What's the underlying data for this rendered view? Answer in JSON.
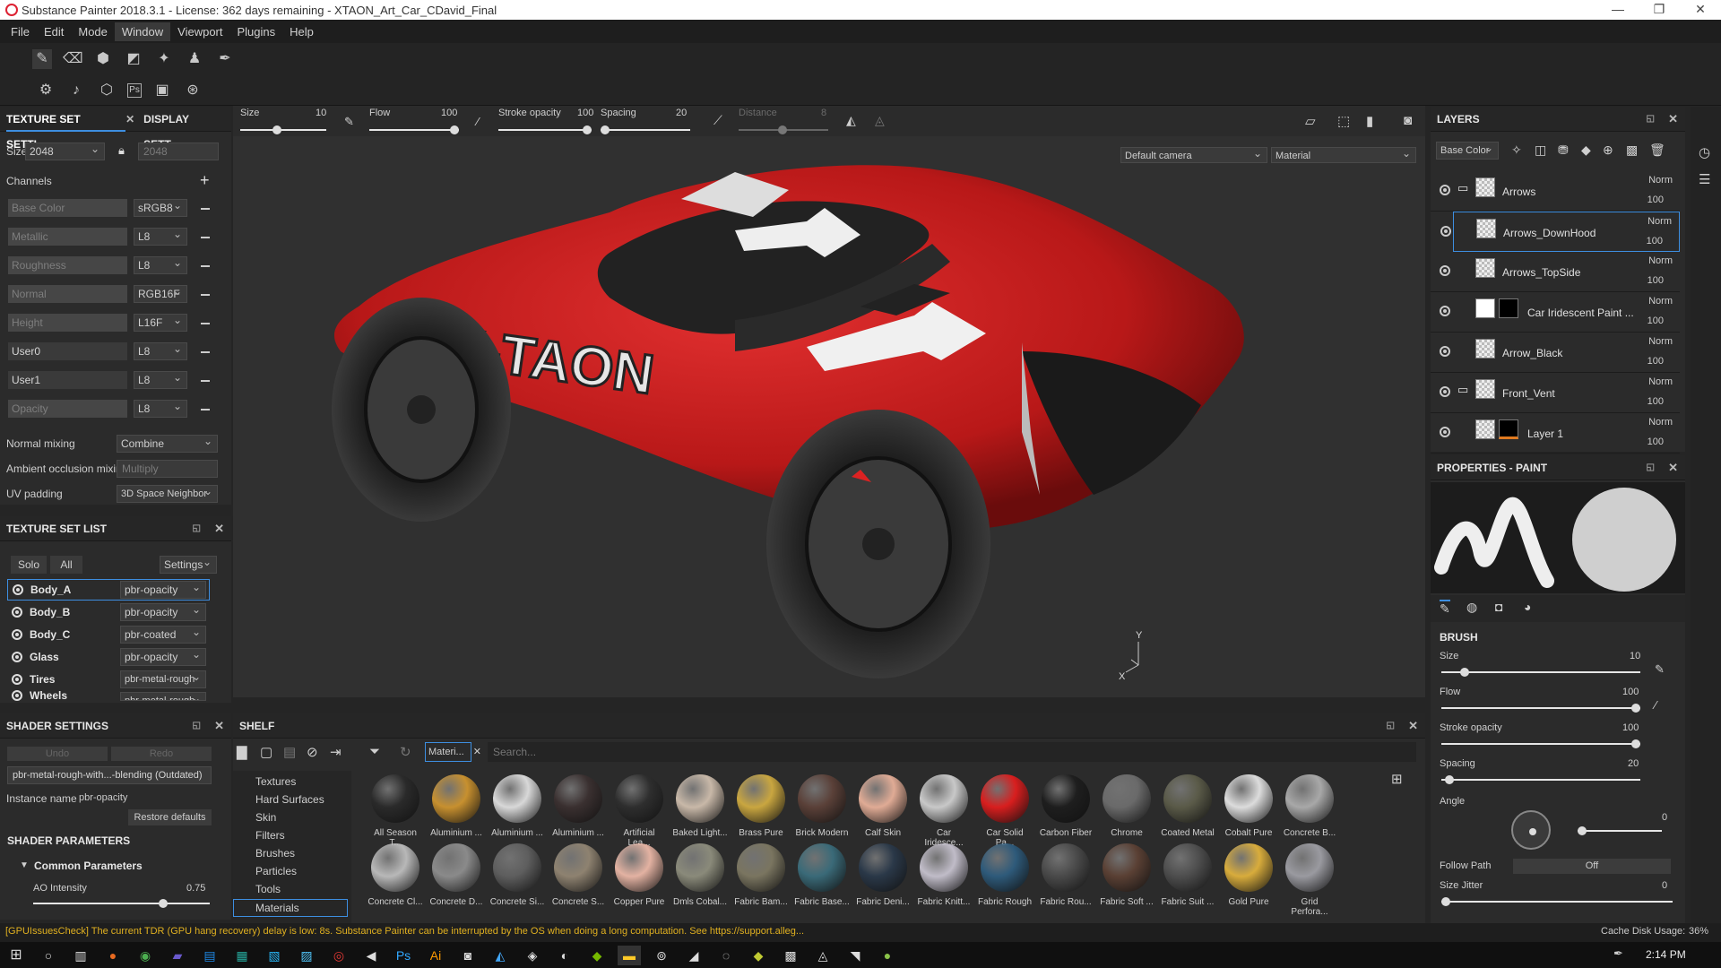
{
  "window": {
    "title": "Substance Painter 2018.3.1 - License: 362 days remaining - XTAON_Art_Car_CDavid_Final",
    "minimize": "—",
    "restore": "❐",
    "close": "✕"
  },
  "menu": [
    "File",
    "Edit",
    "Mode",
    "Window",
    "Viewport",
    "Plugins",
    "Help"
  ],
  "texture_set_settings": {
    "tab1": "TEXTURE SET SETTI...",
    "tab2": "DISPLAY SETT...",
    "size_label": "Size",
    "size_value": "2048",
    "size_value2": "2048",
    "channels_label": "Channels",
    "channels": [
      {
        "name": "Base Color",
        "format": "sRGB8"
      },
      {
        "name": "Metallic",
        "format": "L8"
      },
      {
        "name": "Roughness",
        "format": "L8"
      },
      {
        "name": "Normal",
        "format": "RGB16F"
      },
      {
        "name": "Height",
        "format": "L16F"
      },
      {
        "name": "User0",
        "format": "L8"
      },
      {
        "name": "User1",
        "format": "L8"
      },
      {
        "name": "Opacity",
        "format": "L8"
      }
    ],
    "normal_mixing_label": "Normal mixing",
    "normal_mixing": "Combine",
    "ao_mixing_label": "Ambient occlusion mixing",
    "ao_mixing": "Multiply",
    "uv_padding_label": "UV padding",
    "uv_padding": "3D Space Neighbor"
  },
  "texture_set_list": {
    "title": "TEXTURE SET LIST",
    "solo": "Solo",
    "all": "All",
    "settings": "Settings",
    "items": [
      {
        "name": "Body_A",
        "shader": "pbr-opacity"
      },
      {
        "name": "Body_B",
        "shader": "pbr-opacity"
      },
      {
        "name": "Body_C",
        "shader": "pbr-coated"
      },
      {
        "name": "Glass",
        "shader": "pbr-opacity"
      },
      {
        "name": "Tires",
        "shader": "pbr-metal-rough"
      },
      {
        "name": "Wheels",
        "shader": "pbr-metal-rough"
      }
    ]
  },
  "shader_settings": {
    "title": "SHADER SETTINGS",
    "undo": "Undo",
    "redo": "Redo",
    "shader": "pbr-metal-rough-with...-blending (Outdated)",
    "instance_label": "Instance name",
    "instance_value": "pbr-opacity",
    "restore": "Restore defaults",
    "params_title": "SHADER PARAMETERS",
    "common": "Common Parameters",
    "ao_label": "AO Intensity",
    "ao_value": "0.75",
    "ao_fill": 0.75
  },
  "viewport_toolbar": {
    "size_label": "Size",
    "size_value": "10",
    "flow_label": "Flow",
    "flow_value": "100",
    "stroke_label": "Stroke opacity",
    "stroke_value": "100",
    "spacing_label": "Spacing",
    "spacing_value": "20",
    "distance_label": "Distance",
    "distance_value": "8"
  },
  "viewport": {
    "camera": "Default camera",
    "mode": "Material",
    "decal_text": "X-TAON"
  },
  "layers": {
    "title": "LAYERS",
    "channel": "Base Color",
    "items": [
      {
        "name": "Arrows",
        "blend": "Norm",
        "opacity": "100"
      },
      {
        "name": "Arrows_DownHood",
        "blend": "Norm",
        "opacity": "100"
      },
      {
        "name": "Arrows_TopSide",
        "blend": "Norm",
        "opacity": "100"
      },
      {
        "name": "Car Iridescent Paint ...",
        "blend": "Norm",
        "opacity": "100"
      },
      {
        "name": "Arrow_Black",
        "blend": "Norm",
        "opacity": "100"
      },
      {
        "name": "Front_Vent",
        "blend": "Norm",
        "opacity": "100"
      },
      {
        "name": "Layer 1",
        "blend": "Norm",
        "opacity": "100"
      }
    ]
  },
  "properties": {
    "title": "PROPERTIES - PAINT",
    "brush_title": "BRUSH",
    "size_label": "Size",
    "size_value": "10",
    "size_fill": 0.1,
    "flow_label": "Flow",
    "flow_value": "100",
    "flow_fill": 1.0,
    "stroke_label": "Stroke opacity",
    "stroke_value": "100",
    "stroke_fill": 1.0,
    "spacing_label": "Spacing",
    "spacing_value": "20",
    "spacing_fill": 0.02,
    "angle_label": "Angle",
    "angle_value": "0",
    "follow_label": "Follow Path",
    "follow_value": "Off",
    "jitter_label": "Size Jitter",
    "jitter_value": "0"
  },
  "shelf": {
    "title": "SHELF",
    "filter_tag": "Materi...",
    "search_placeholder": "Search...",
    "categories": [
      "Textures",
      "Hard Surfaces",
      "Skin",
      "Filters",
      "Brushes",
      "Particles",
      "Tools",
      "Materials"
    ],
    "materials_row1": [
      {
        "name": "All Season T...",
        "color": "#2a2a2a"
      },
      {
        "name": "Aluminium ...",
        "color": "#c7902f"
      },
      {
        "name": "Aluminium ...",
        "color": "#d8d8d8"
      },
      {
        "name": "Aluminium ...",
        "color": "#3a3030"
      },
      {
        "name": "Artificial Lea...",
        "color": "#2e2e2e"
      },
      {
        "name": "Baked Light...",
        "color": "#c8b8a8"
      },
      {
        "name": "Brass Pure",
        "color": "#c9a640"
      },
      {
        "name": "Brick Modern",
        "color": "#5a4038"
      },
      {
        "name": "Calf Skin",
        "color": "#e0ab95"
      },
      {
        "name": "Car Iridesce...",
        "color": "#c8c8c8"
      },
      {
        "name": "Car Solid Pa...",
        "color": "#d81e1e"
      },
      {
        "name": "Carbon Fiber",
        "color": "#1e1e1e"
      },
      {
        "name": "Chrome",
        "color": "#6a6a6a"
      },
      {
        "name": "Coated Metal",
        "color": "#5a5a48"
      },
      {
        "name": "Cobalt Pure",
        "color": "#dcdcdc"
      },
      {
        "name": "Concrete B...",
        "color": "#a8a8a8"
      }
    ],
    "materials_row2": [
      {
        "name": "Concrete Cl...",
        "color": "#b8b8b8"
      },
      {
        "name": "Concrete D...",
        "color": "#8a8a8a"
      },
      {
        "name": "Concrete Si...",
        "color": "#5e5e5e"
      },
      {
        "name": "Concrete S...",
        "color": "#8e8270"
      },
      {
        "name": "Copper Pure",
        "color": "#e3b2a2"
      },
      {
        "name": "Dmls Cobal...",
        "color": "#8a8a7a"
      },
      {
        "name": "Fabric Bam...",
        "color": "#7a7560"
      },
      {
        "name": "Fabric Base...",
        "color": "#3a6a78"
      },
      {
        "name": "Fabric Deni...",
        "color": "#2a3848"
      },
      {
        "name": "Fabric Knitt...",
        "color": "#c0bcc8"
      },
      {
        "name": "Fabric Rough",
        "color": "#2e5a7a"
      },
      {
        "name": "Fabric Rou...",
        "color": "#4a4a4a"
      },
      {
        "name": "Fabric Soft ...",
        "color": "#5a4034"
      },
      {
        "name": "Fabric Suit ...",
        "color": "#4e4e4e"
      },
      {
        "name": "Gold Pure",
        "color": "#d8ac3c"
      },
      {
        "name": "Grid Perfora...",
        "color": "#9a9aa0"
      }
    ]
  },
  "status": {
    "message": "[GPUIssuesCheck] The current TDR (GPU hang recovery) delay is low: 8s. Substance Painter can be interrupted by the OS when doing a long computation. See https://support.alleg...",
    "cache": "Cache Disk Usage:",
    "cache_value": "36%"
  },
  "taskbar": {
    "time": "2:14 PM"
  },
  "colors": {
    "accent": "#3d8ee0",
    "status_text": "#e0b020",
    "car": "#c41a1a"
  }
}
